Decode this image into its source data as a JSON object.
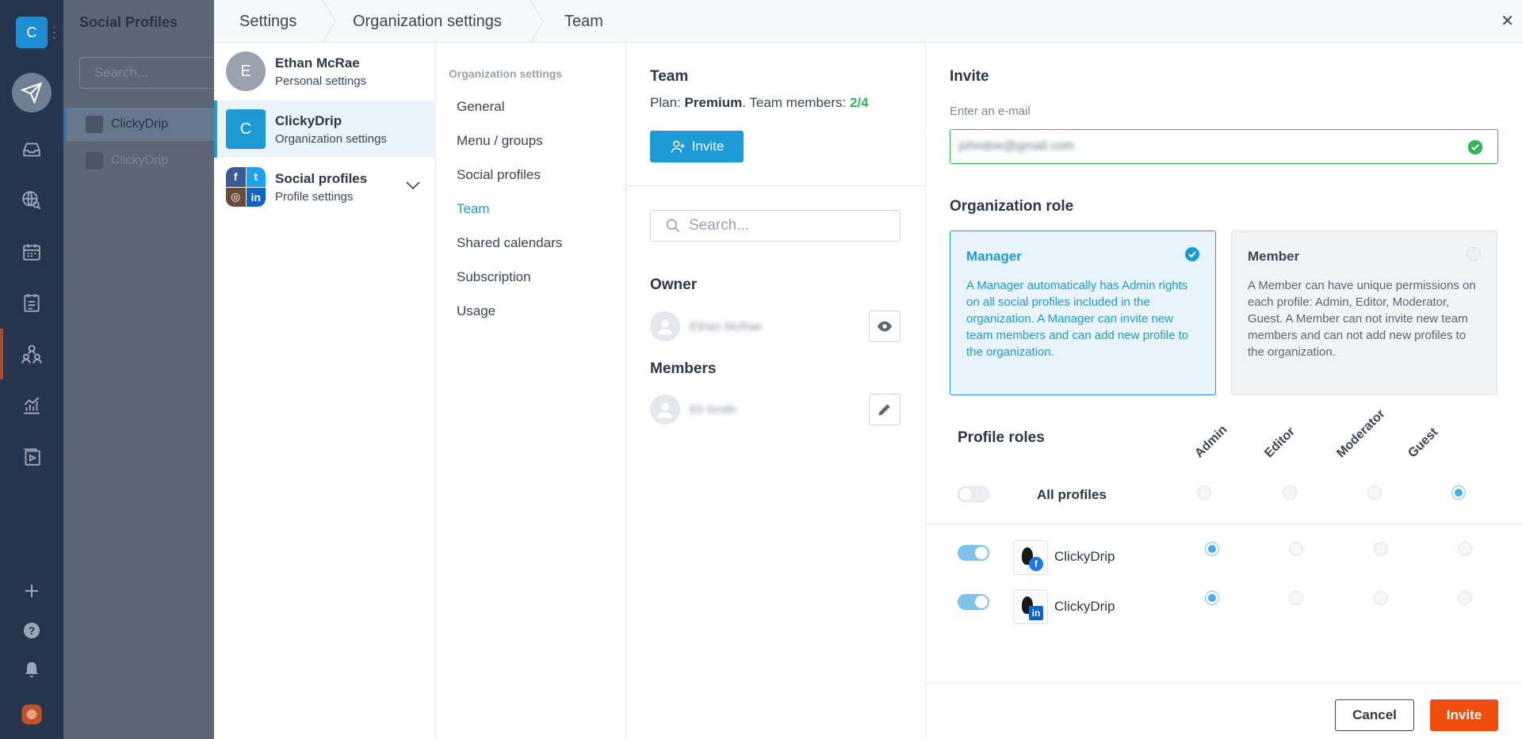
{
  "rail": {
    "org_initial": "C",
    "icons": [
      "send-icon",
      "inbox-icon",
      "listening-icon",
      "calendar-icon",
      "planner-icon",
      "team-icon",
      "analytics-icon",
      "media-icon",
      "plus-icon",
      "help-icon",
      "bell-icon",
      "user-icon"
    ]
  },
  "background_panel": {
    "title": "Social Profiles",
    "search_placeholder": "Search...",
    "items": [
      {
        "label": "ClickyDrip"
      },
      {
        "label": "ClickyDrip"
      }
    ]
  },
  "breadcrumb": {
    "items": [
      "Settings",
      "Organization settings",
      "Team"
    ]
  },
  "accounts": [
    {
      "initial": "E",
      "name": "Ethan McRae",
      "sub": "Personal settings"
    },
    {
      "initial": "C",
      "name": "ClickyDrip",
      "sub": "Organization settings"
    },
    {
      "name": "Social profiles",
      "sub": "Profile settings"
    }
  ],
  "org_nav": {
    "heading": "Organization settings",
    "links": [
      "General",
      "Menu / groups",
      "Social profiles",
      "Team",
      "Shared calendars",
      "Subscription",
      "Usage"
    ],
    "active": "Team"
  },
  "team": {
    "title": "Team",
    "plan_prefix": "Plan: ",
    "plan_name": "Premium",
    "members_prefix": ". Team members: ",
    "members_count": "2/4",
    "invite_label": "Invite",
    "search_placeholder": "Search...",
    "owner_heading": "Owner",
    "owner_name": "Ethan McRae",
    "members_heading": "Members",
    "member_name": "Eli Smith"
  },
  "invite": {
    "title": "Invite",
    "email_label": "Enter an e-mail",
    "email_value": "johndoe@gmail.com",
    "org_role_heading": "Organization role",
    "roles": [
      {
        "title": "Manager",
        "desc": "A Manager automatically has Admin rights on all social profiles included in the organization. A Manager can invite new team members and can add new profile to the organization.",
        "selected": true
      },
      {
        "title": "Member",
        "desc": "A Member can have unique permissions on each profile: Admin, Editor, Moderator, Guest. A Member can not invite new team members and can not add new profiles to the organization.",
        "selected": false
      }
    ],
    "profile_roles_heading": "Profile roles",
    "columns": [
      "Admin",
      "Editor",
      "Moderator",
      "Guest"
    ],
    "all_profiles_label": "All profiles",
    "all_profiles_role": "Guest",
    "profiles": [
      {
        "name": "ClickyDrip",
        "network": "facebook",
        "badge": "f",
        "enabled": true,
        "role": "Admin"
      },
      {
        "name": "ClickyDrip",
        "network": "linkedin",
        "badge": "in",
        "enabled": true,
        "role": "Admin"
      }
    ],
    "cancel_label": "Cancel",
    "submit_label": "Invite"
  },
  "colors": {
    "accent": "#1c9ad6",
    "success": "#2fb55a",
    "primary_action": "#f04e0c",
    "facebook": "#1877f2",
    "linkedin": "#0a66c2"
  }
}
